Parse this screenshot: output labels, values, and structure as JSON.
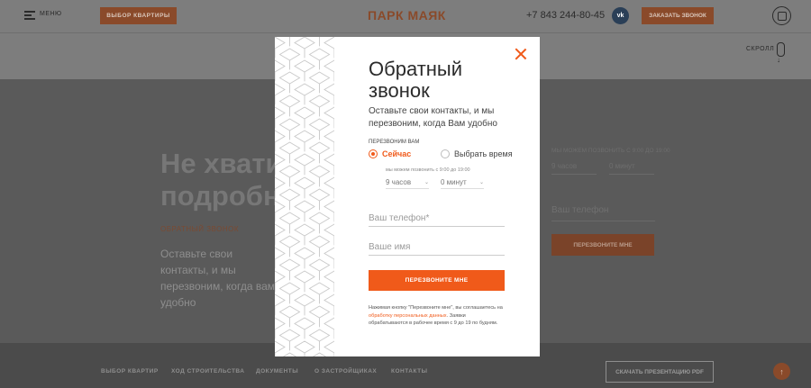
{
  "header": {
    "menu_label": "МЕНЮ",
    "choose_button": "ВЫБОР КВАРТИРЫ",
    "logo": "ПАРК МАЯК",
    "phone": "+7 843 244-80-45",
    "vk_label": "vk",
    "call_button": "ЗАКАЗАТЬ ЗВОНОК"
  },
  "scroll": {
    "label": "СКРОЛЛ"
  },
  "background": {
    "title_line1": "Не хвати",
    "title_line2": "подробн",
    "subtitle": "ОБРАТНЫЙ ЗВОНОК",
    "text": "Оставьте свои контакты, и мы перезвоним, когда вам удобно",
    "hint": "МЫ МОЖЕМ ПОЗВОНИТЬ С 9:00 ДО 19:00",
    "hours": "9 часов",
    "minutes": "0 минут",
    "phone_placeholder": "Ваш телефон",
    "button": "ПЕРЕЗВОНИТЕ МНЕ"
  },
  "footer": {
    "links": [
      "ВЫБОР КВАРТИР",
      "ХОД СТРОИТЕЛЬСТВА",
      "ДОКУМЕНТЫ",
      "О ЗАСТРОЙЩИКАХ",
      "КОНТАКТЫ"
    ],
    "presentation_button": "СКАЧАТЬ ПРЕЗЕНТАЦИЮ PDF",
    "up_arrow": "↑"
  },
  "modal": {
    "title": "Обратный звонок",
    "description": "Оставьте свои контакты, и мы перезвоним, когда Вам удобно",
    "callback_label": "ПЕРЕЗВОНИМ ВАМ",
    "option_now": "Сейчас",
    "option_choose_time": "Выбрать время",
    "time_hint": "мы можем позвонить с 9:00 до 19:00",
    "hours": "9 часов",
    "minutes": "0 минут",
    "phone_placeholder": "Ваш телефон*",
    "name_placeholder": "Ваше имя",
    "submit": "ПЕРЕЗВОНИТЕ МНЕ",
    "note_before": "Нажимая кнопку \"Перезвоните мне\", вы соглашаетесь на ",
    "note_link": "обработку персональных данных",
    "note_after": ". Заявки обрабатываются в рабочее время с 9 до 19 по будням."
  },
  "colors": {
    "accent": "#f05a1a",
    "overlay": "#5a5a5a"
  }
}
